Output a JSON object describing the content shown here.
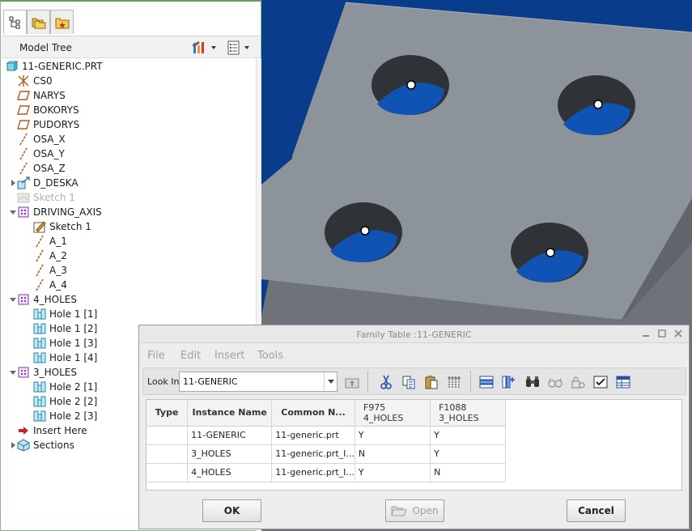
{
  "model_tree": {
    "title": "Model Tree",
    "items": [
      {
        "label": "11-GENERIC.PRT",
        "icon": "part-icon",
        "depth": 0,
        "expander": ""
      },
      {
        "label": "CS0",
        "icon": "csys-icon",
        "depth": 1,
        "expander": ""
      },
      {
        "label": "NARYS",
        "icon": "datum-plane-icon",
        "depth": 1,
        "expander": ""
      },
      {
        "label": "BOKORYS",
        "icon": "datum-plane-icon",
        "depth": 1,
        "expander": ""
      },
      {
        "label": "PUDORYS",
        "icon": "datum-plane-icon",
        "depth": 1,
        "expander": ""
      },
      {
        "label": "OSA_X",
        "icon": "datum-axis-icon",
        "depth": 1,
        "expander": ""
      },
      {
        "label": "OSA_Y",
        "icon": "datum-axis-icon",
        "depth": 1,
        "expander": ""
      },
      {
        "label": "OSA_Z",
        "icon": "datum-axis-icon",
        "depth": 1,
        "expander": ""
      },
      {
        "label": "D_DESKA",
        "icon": "extrude-icon",
        "depth": 1,
        "expander": "right"
      },
      {
        "label": "Sketch 1",
        "icon": "sketch-suppressed-icon",
        "depth": 1,
        "expander": "",
        "dim": true
      },
      {
        "label": "DRIVING_AXIS",
        "icon": "group-icon",
        "depth": 1,
        "expander": "down"
      },
      {
        "label": "Sketch 1",
        "icon": "sketch-icon",
        "depth": 2,
        "expander": ""
      },
      {
        "label": "A_1",
        "icon": "datum-axis-icon",
        "depth": 2,
        "expander": ""
      },
      {
        "label": "A_2",
        "icon": "datum-axis-icon",
        "depth": 2,
        "expander": ""
      },
      {
        "label": "A_3",
        "icon": "datum-axis-icon",
        "depth": 2,
        "expander": ""
      },
      {
        "label": "A_4",
        "icon": "datum-axis-icon",
        "depth": 2,
        "expander": ""
      },
      {
        "label": "4_HOLES",
        "icon": "group-icon",
        "depth": 1,
        "expander": "down"
      },
      {
        "label": "Hole 1 [1]",
        "icon": "hole-icon",
        "depth": 2,
        "expander": ""
      },
      {
        "label": "Hole 1 [2]",
        "icon": "hole-icon",
        "depth": 2,
        "expander": ""
      },
      {
        "label": "Hole 1 [3]",
        "icon": "hole-icon",
        "depth": 2,
        "expander": ""
      },
      {
        "label": "Hole 1 [4]",
        "icon": "hole-icon",
        "depth": 2,
        "expander": ""
      },
      {
        "label": "3_HOLES",
        "icon": "group-icon",
        "depth": 1,
        "expander": "down"
      },
      {
        "label": "Hole 2 [1]",
        "icon": "hole-icon",
        "depth": 2,
        "expander": ""
      },
      {
        "label": "Hole 2 [2]",
        "icon": "hole-icon",
        "depth": 2,
        "expander": ""
      },
      {
        "label": "Hole 2 [3]",
        "icon": "hole-icon",
        "depth": 2,
        "expander": ""
      },
      {
        "label": "Insert Here",
        "icon": "insert-here-arrow-icon",
        "depth": 1,
        "expander": ""
      },
      {
        "label": "Sections",
        "icon": "sections-icon",
        "depth": 1,
        "expander": "right"
      }
    ]
  },
  "dialog": {
    "title": "Family Table :11-GENERIC",
    "menu": [
      "File",
      "Edit",
      "Insert",
      "Tools"
    ],
    "look_in_label": "Look In:",
    "look_in_value": "11-GENERIC",
    "columns": [
      {
        "label": "Type"
      },
      {
        "label": "Instance Name"
      },
      {
        "label": "Common N..."
      },
      {
        "label": "F975",
        "sub": "4_HOLES"
      },
      {
        "label": "F1088",
        "sub": "3_HOLES"
      }
    ],
    "rows": [
      {
        "type": "",
        "instance": "11-GENERIC",
        "common": "11-generic.prt",
        "f975": "Y",
        "f1088": "Y"
      },
      {
        "type": "",
        "instance": "3_HOLES",
        "common": "11-generic.prt_I...",
        "f975": "N",
        "f1088": "Y"
      },
      {
        "type": "",
        "instance": "4_HOLES",
        "common": "11-generic.prt_I...",
        "f975": "Y",
        "f1088": "N"
      }
    ],
    "buttons": {
      "ok": "OK",
      "open": "Open",
      "cancel": "Cancel"
    }
  },
  "colors": {
    "viewport_bg": "#0a3c8c",
    "plate_top": "#8c939a",
    "plate_side": "#6d7379",
    "hole_inner": "#2f3338",
    "hole_through": "#0f54b4"
  }
}
